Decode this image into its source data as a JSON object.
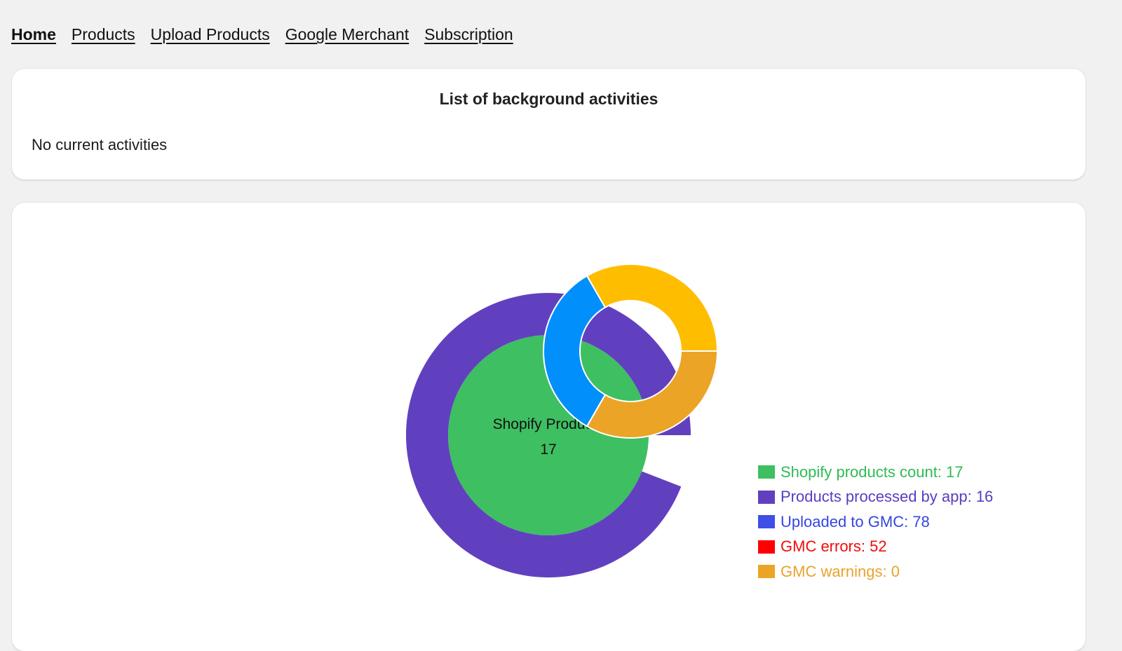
{
  "nav": {
    "items": [
      {
        "label": "Home",
        "active": true
      },
      {
        "label": "Products",
        "active": false
      },
      {
        "label": "Upload Products",
        "active": false
      },
      {
        "label": "Google Merchant",
        "active": false
      },
      {
        "label": "Subscription",
        "active": false
      }
    ]
  },
  "activities": {
    "title": "List of background activities",
    "empty_text": "No current activities"
  },
  "chart_data": {
    "type": "pie",
    "title": "",
    "center_label": "Shopify Products",
    "center_value": "17",
    "main_donut": {
      "inner_disc": {
        "name": "Shopify products count",
        "value": 17,
        "color": "#3ebf62"
      },
      "outer_ring": {
        "name": "Products processed by app",
        "value": 16,
        "of_total": 17,
        "color": "#6140bf"
      }
    },
    "gmc_donut": {
      "segments": [
        {
          "name": "Uploaded to GMC",
          "value": 78,
          "share": 0.3333,
          "color": "#008ffb"
        },
        {
          "name": "GMC errors",
          "value": 52,
          "share": 0.3333,
          "color": "#ffbd00"
        },
        {
          "name": "GMC warnings",
          "value": 0,
          "share": 0.3333,
          "color": "#eca426"
        }
      ]
    },
    "legend_position": "bottom-right",
    "legend": [
      {
        "label": "Shopify products count: 17",
        "swatch": "#3ebf62",
        "text_color": "#2fbb55"
      },
      {
        "label": "Products processed by app: 16",
        "swatch": "#6140bf",
        "text_color": "#5a3cc0"
      },
      {
        "label": "Uploaded to GMC: 78",
        "swatch": "#3f4ee6",
        "text_color": "#3546e0"
      },
      {
        "label": "GMC errors: 52",
        "swatch": "#ff0000",
        "text_color": "#f00c0c"
      },
      {
        "label": "GMC warnings: 0",
        "swatch": "#eca426",
        "text_color": "#e9a22e"
      }
    ]
  }
}
